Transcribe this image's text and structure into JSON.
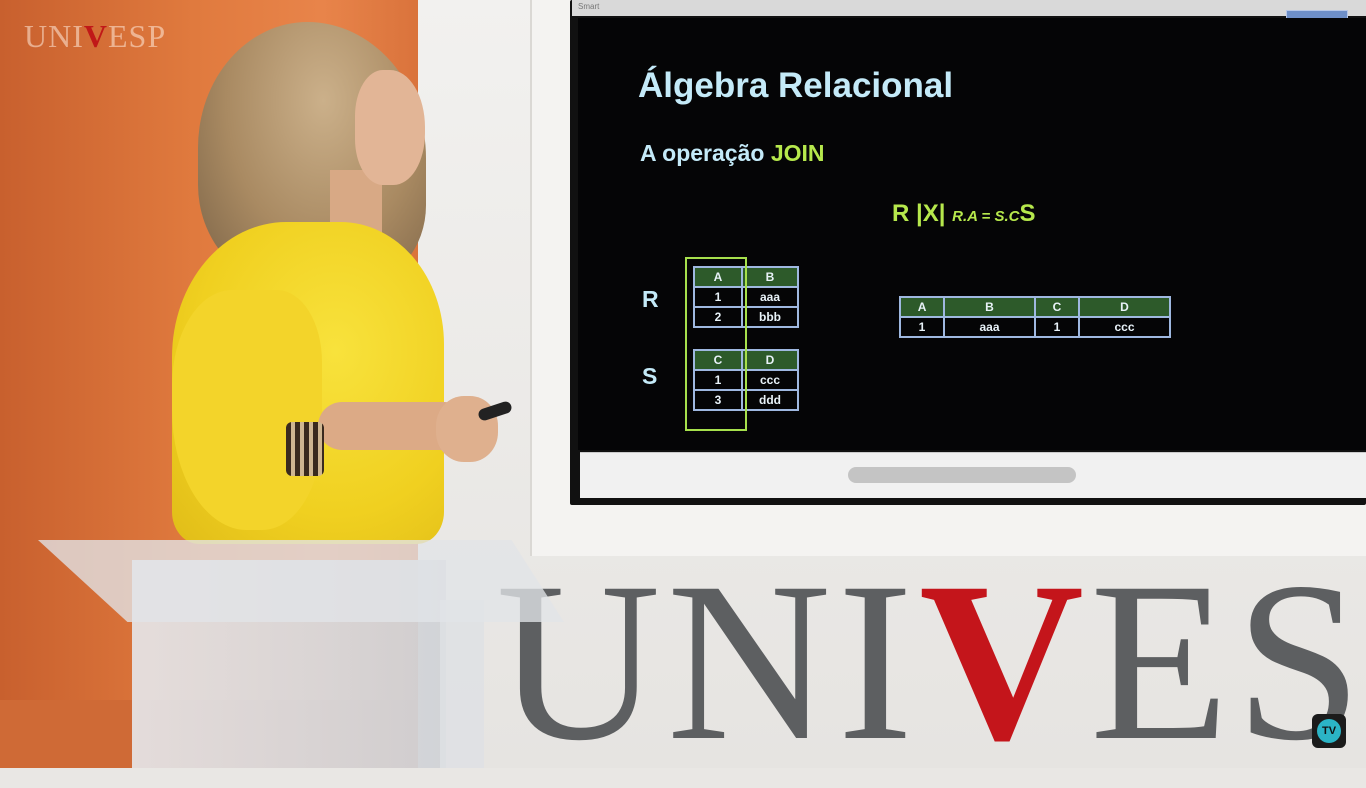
{
  "corner_logo": {
    "prefix": "UNI",
    "v": "V",
    "suffix": "ESP"
  },
  "screen": {
    "topbar_label": "Smart",
    "slide": {
      "title": "Álgebra Relacional",
      "subtitle_prefix": "A operação ",
      "subtitle_keyword": "JOIN",
      "join_expression": {
        "left": "R |X| ",
        "condition": "R.A = S.C",
        "right": "S"
      },
      "relation_r": {
        "label": "R",
        "headers": [
          "A",
          "B"
        ],
        "rows": [
          [
            "1",
            "aaa"
          ],
          [
            "2",
            "bbb"
          ]
        ]
      },
      "relation_s": {
        "label": "S",
        "headers": [
          "C",
          "D"
        ],
        "rows": [
          [
            "1",
            "ccc"
          ],
          [
            "3",
            "ddd"
          ]
        ]
      },
      "result": {
        "headers": [
          "A",
          "B",
          "C",
          "D"
        ],
        "rows": [
          [
            "1",
            "aaa",
            "1",
            "ccc"
          ]
        ]
      }
    }
  },
  "wall_logo": {
    "prefix": "UNI",
    "v": "V",
    "suffix": "ES"
  },
  "tv_badge": "TV",
  "colors": {
    "accent_green": "#b6e84c",
    "slide_text": "#c4eaf8",
    "header_fill": "#2d5a2a",
    "logo_red": "#c4151b"
  }
}
